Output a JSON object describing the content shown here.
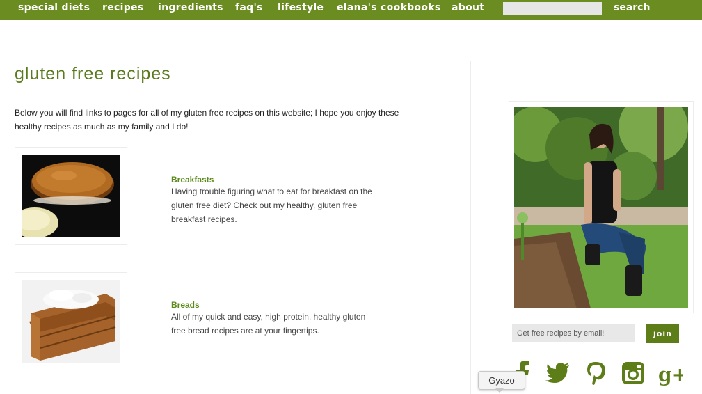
{
  "nav": {
    "items": [
      {
        "label": "special diets"
      },
      {
        "label": "recipes"
      },
      {
        "label": "ingredients"
      },
      {
        "label": "faq's"
      },
      {
        "label": "lifestyle"
      },
      {
        "label": "elana's cookbooks"
      },
      {
        "label": "about"
      }
    ],
    "search_value": "",
    "search_label": "search"
  },
  "main": {
    "title": "gluten free recipes",
    "intro": "Below you will find links to pages for all of my gluten free recipes on this website; I hope you enjoy these healthy recipes as much as my family and I do!",
    "categories": [
      {
        "title": "Breakfasts",
        "description": "Having trouble figuring what to eat for breakfast on the gluten free diet? Check out my healthy, gluten free breakfast recipes.",
        "image": "pancake-photo"
      },
      {
        "title": "Breads",
        "description": "All of my quick and easy, high protein, healthy gluten free bread recipes are at your fingertips.",
        "image": "bread-photo"
      }
    ]
  },
  "sidebar": {
    "photo": "author-garden-photo",
    "email_placeholder": "Get free recipes by email!",
    "join_label": "join",
    "social": [
      "facebook-icon",
      "twitter-icon",
      "pinterest-icon",
      "instagram-icon",
      "google-plus-icon"
    ]
  },
  "overlay": {
    "tooltip": "Gyazo"
  },
  "colors": {
    "nav_bg": "#6b8c21",
    "title_green": "#5a7a1e",
    "link_green": "#5a8a1a",
    "join_bg": "#5d7d18",
    "icon_green": "#5d7d18"
  }
}
